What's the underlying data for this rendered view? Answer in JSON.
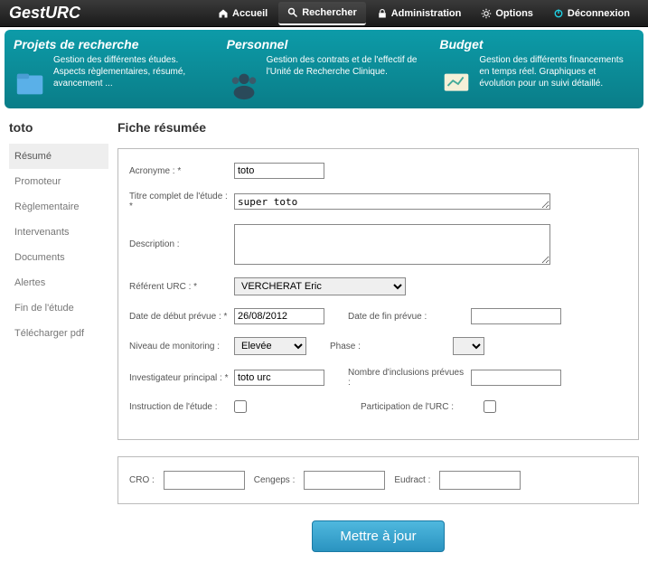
{
  "app": {
    "name": "GestURC"
  },
  "topnav": [
    {
      "label": "Accueil",
      "icon": "home"
    },
    {
      "label": "Rechercher",
      "icon": "search",
      "active": true
    },
    {
      "label": "Administration",
      "icon": "lock"
    },
    {
      "label": "Options",
      "icon": "gear"
    },
    {
      "label": "Déconnexion",
      "icon": "power"
    }
  ],
  "banner": [
    {
      "title": "Projets de recherche",
      "desc": "Gestion des différentes études. Aspects règlementaires, résumé, avancement ..."
    },
    {
      "title": "Personnel",
      "desc": "Gestion des contrats et de l'effectif de l'Unité de Recherche Clinique."
    },
    {
      "title": "Budget",
      "desc": "Gestion des différents financements en temps réel. Graphiques et évolution pour un suivi détaillé."
    }
  ],
  "sidebar": {
    "title": "toto",
    "items": [
      "Résumé",
      "Promoteur",
      "Règlementaire",
      "Intervenants",
      "Documents",
      "Alertes",
      "Fin de l'étude",
      "Télécharger pdf"
    ],
    "active": 0
  },
  "page": {
    "title": "Fiche résumée"
  },
  "form": {
    "acronyme": {
      "label": "Acronyme : *",
      "value": "toto"
    },
    "titre": {
      "label": "Titre complet de l'étude : *",
      "value": "super toto"
    },
    "description": {
      "label": "Description :",
      "value": ""
    },
    "referent": {
      "label": "Référent URC : *",
      "value": "VERCHERAT Eric"
    },
    "date_debut": {
      "label": "Date de début prévue : *",
      "value": "26/08/2012"
    },
    "date_fin": {
      "label": "Date de fin prévue :",
      "value": ""
    },
    "monitoring": {
      "label": "Niveau de monitoring :",
      "value": "Elevée"
    },
    "phase": {
      "label": "Phase :",
      "value": ""
    },
    "investigateur": {
      "label": "Investigateur principal : *",
      "value": "toto urc"
    },
    "inclusions": {
      "label": "Nombre d'inclusions prévues :",
      "value": ""
    },
    "instruction": {
      "label": "Instruction de l'étude :"
    },
    "participation": {
      "label": "Participation de l'URC :"
    },
    "cro": {
      "label": "CRO :",
      "value": ""
    },
    "cengeps": {
      "label": "Cengeps :",
      "value": ""
    },
    "eudract": {
      "label": "Eudract :",
      "value": ""
    },
    "submit": "Mettre à jour"
  }
}
